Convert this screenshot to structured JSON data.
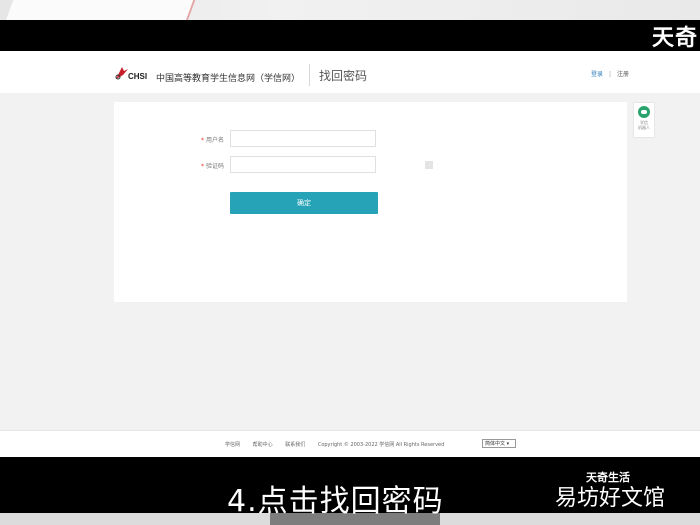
{
  "site": {
    "logo_text": "CHSI",
    "name": "中国高等教育学生信息网（学信网）",
    "page_title": "找回密码"
  },
  "header": {
    "login": "登录",
    "separator": "|",
    "register": "注册"
  },
  "form": {
    "username_label": "用户名",
    "captcha_label": "验证码",
    "required_mark": "*",
    "username_value": "",
    "captcha_value": "",
    "confirm_label": "确定"
  },
  "robot": {
    "label_line1": "学信",
    "label_line2": "机器人"
  },
  "footer": {
    "links": [
      "学信网",
      "帮助中心",
      "联系我们"
    ],
    "copyright": "Copyright © 2003-2022  学信网  All Rights Reserved",
    "language": "简体中文"
  },
  "video": {
    "caption": "4.点击找回密码",
    "watermark_top": "天奇",
    "watermark_brand": "天奇生活",
    "watermark_site": "易坊好文馆"
  },
  "colors": {
    "accent": "#27a3b7",
    "link": "#2f7fc0",
    "required": "#ee3333"
  }
}
